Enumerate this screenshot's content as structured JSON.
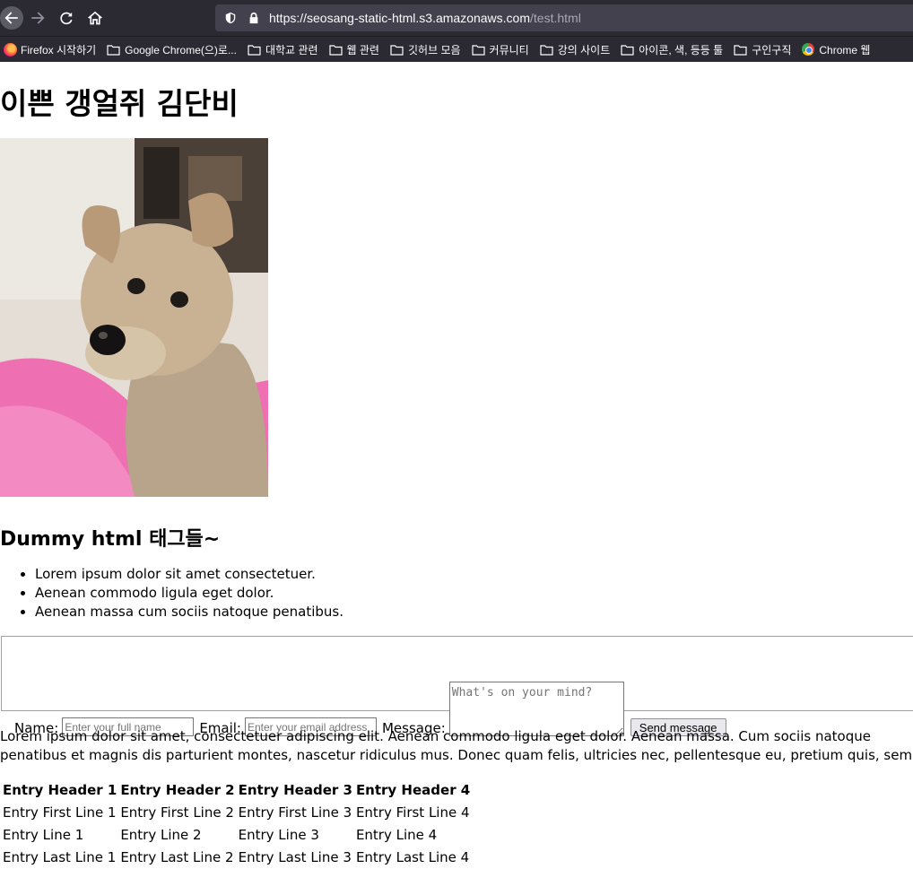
{
  "browser": {
    "url_host": "https://seosang-static-html.s3.amazonaws.com",
    "url_path": "/test.html",
    "bookmarks": [
      {
        "label": "Firefox 시작하기",
        "icon": "firefox-icon"
      },
      {
        "label": "Google Chrome(으)로...",
        "icon": "folder-icon"
      },
      {
        "label": "대학교 관련",
        "icon": "folder-icon"
      },
      {
        "label": "웹 관련",
        "icon": "folder-icon"
      },
      {
        "label": "깃허브 모음",
        "icon": "folder-icon"
      },
      {
        "label": "커뮤니티",
        "icon": "folder-icon"
      },
      {
        "label": "강의 사이트",
        "icon": "folder-icon"
      },
      {
        "label": "아이콘, 색, 등등 툴",
        "icon": "folder-icon"
      },
      {
        "label": "구인구직",
        "icon": "folder-icon"
      },
      {
        "label": "Chrome 웹",
        "icon": "chrome-icon"
      }
    ]
  },
  "page": {
    "title": "이쁜 갱얼쥐 김단비",
    "subtitle": "Dummy html 태그들~",
    "list_items": [
      "Lorem ipsum dolor sit amet consectetuer.",
      "Aenean commodo ligula eget dolor.",
      "Aenean massa cum sociis natoque penatibus."
    ],
    "form": {
      "name_label": "Name:",
      "name_placeholder": "Enter your full name",
      "email_label": "Email:",
      "email_placeholder": "Enter your email address",
      "message_label": "Message:",
      "message_placeholder": "What's on your mind?",
      "submit_label": "Send message"
    },
    "paragraph": "Lorem ipsum dolor sit amet, consectetuer adipiscing elit. Aenean commodo ligula eget dolor. Aenean massa. Cum sociis natoque penatibus et magnis dis parturient montes, nascetur ridiculus mus. Donec quam felis, ultricies nec, pellentesque eu, pretium quis, sem.",
    "table": {
      "headers": [
        "Entry Header 1",
        "Entry Header 2",
        "Entry Header 3",
        "Entry Header 4"
      ],
      "rows": [
        [
          "Entry First Line 1",
          "Entry First Line 2",
          "Entry First Line 3",
          "Entry First Line 4"
        ],
        [
          "Entry Line 1",
          "Entry Line 2",
          "Entry Line 3",
          "Entry Line 4"
        ],
        [
          "Entry Last Line 1",
          "Entry Last Line 2",
          "Entry Last Line 3",
          "Entry Last Line 4"
        ]
      ]
    }
  }
}
